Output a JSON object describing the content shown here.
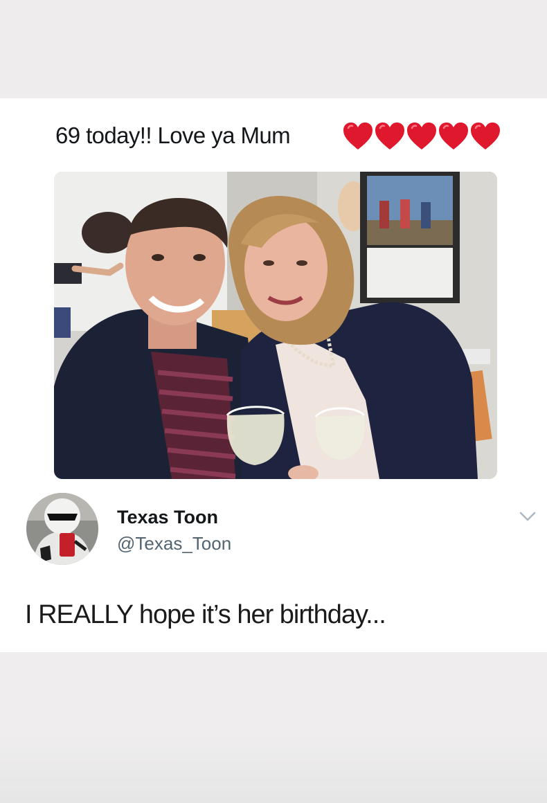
{
  "post": {
    "caption": "69 today!! Love ya Mum",
    "heart_count": 5,
    "heart_color": "#e0182d"
  },
  "reply": {
    "display_name": "Texas Toon",
    "handle": "@Texas_Toon",
    "text": "I REALLY hope it’s her birthday..."
  },
  "icons": {
    "hearts": "red-heart-icon",
    "menu": "chevron-down-icon"
  },
  "colors": {
    "page_background": "#eeeced",
    "card_background": "#ffffff",
    "handle_gray": "#536471"
  }
}
